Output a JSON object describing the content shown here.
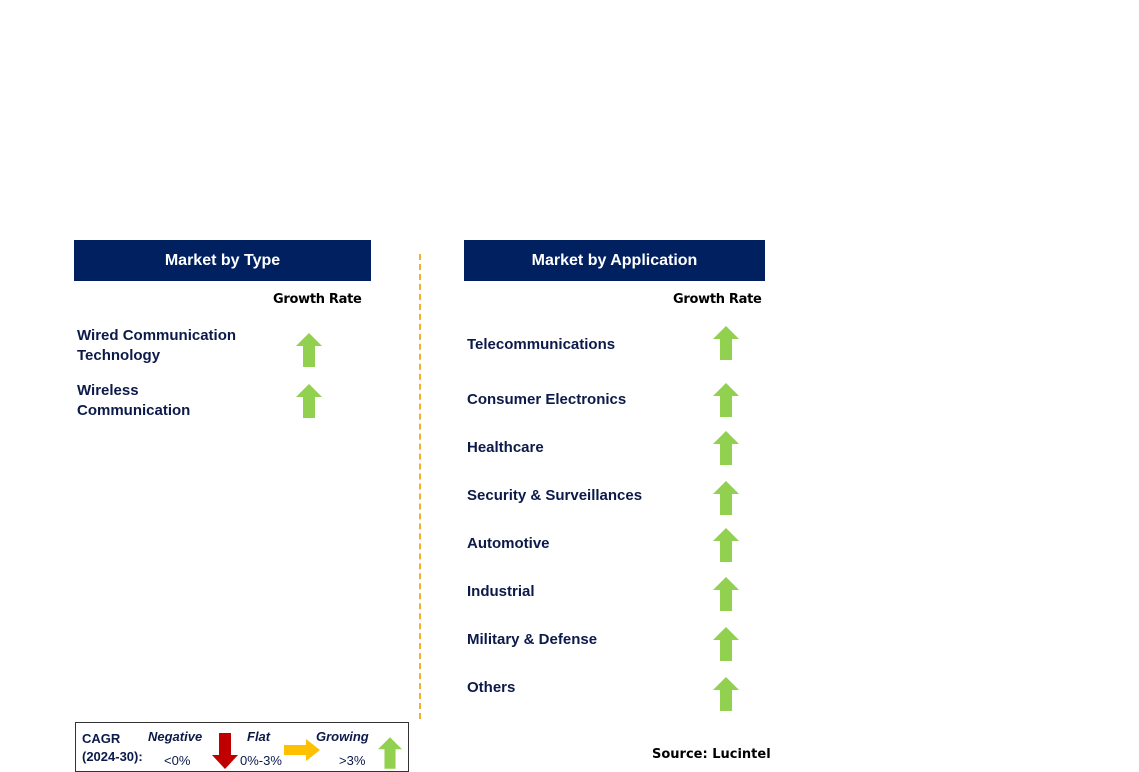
{
  "type_panel": {
    "title": "Market by Type",
    "growth_label": "Growth Rate",
    "items": [
      {
        "label": "Wired Communication Technology",
        "trend": "growing"
      },
      {
        "label": "Wireless Communication",
        "trend": "growing"
      }
    ]
  },
  "application_panel": {
    "title": "Market by Application",
    "growth_label": "Growth Rate",
    "items": [
      {
        "label": "Telecommunications",
        "trend": "growing"
      },
      {
        "label": "Consumer Electronics",
        "trend": "growing"
      },
      {
        "label": "Healthcare",
        "trend": "growing"
      },
      {
        "label": "Security & Surveillances",
        "trend": "growing"
      },
      {
        "label": "Automotive",
        "trend": "growing"
      },
      {
        "label": "Industrial",
        "trend": "growing"
      },
      {
        "label": "Military & Defense",
        "trend": "growing"
      },
      {
        "label": "Others",
        "trend": "growing"
      }
    ]
  },
  "legend": {
    "cagr": "CAGR",
    "period": "(2024-30):",
    "negative": "Negative",
    "negative_range": "<0%",
    "flat": "Flat",
    "flat_range": "0%-3%",
    "growing": "Growing",
    "growing_range": ">3%"
  },
  "source": "Source: Lucintel",
  "colors": {
    "header": "#002060",
    "growing": "#92d050",
    "flat": "#ffc000",
    "negative": "#c00000",
    "text": "#0c1a4a"
  }
}
